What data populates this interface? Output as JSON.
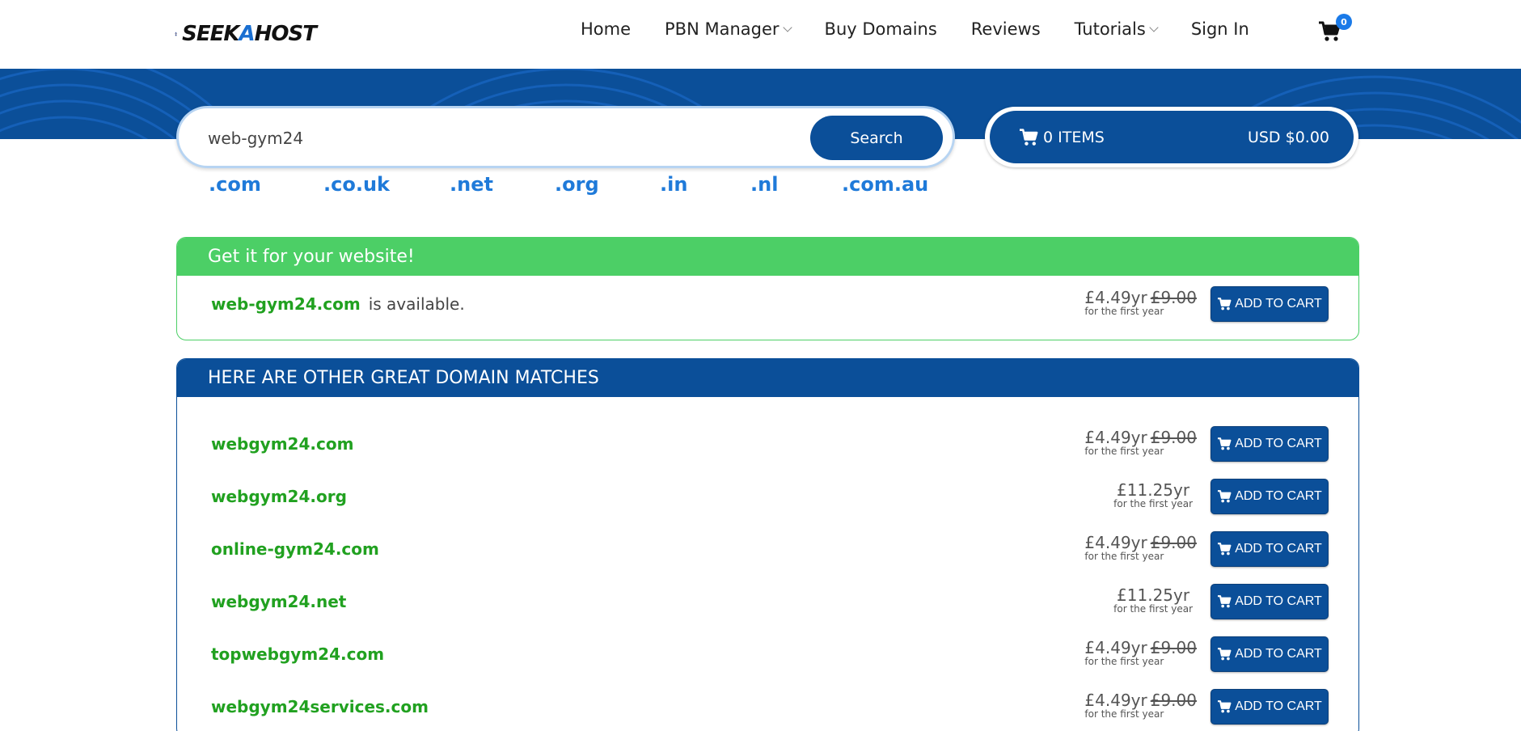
{
  "header": {
    "logo_text_1": "SEEK",
    "logo_text_2": "A",
    "logo_text_3": "HOST",
    "nav": [
      {
        "label": "Home",
        "dropdown": false
      },
      {
        "label": "PBN Manager",
        "dropdown": true
      },
      {
        "label": "Buy Domains",
        "dropdown": false
      },
      {
        "label": "Reviews",
        "dropdown": false
      },
      {
        "label": "Tutorials",
        "dropdown": true
      },
      {
        "label": "Sign In",
        "dropdown": false
      }
    ],
    "cart_count": "0"
  },
  "search": {
    "value": "web-gym24",
    "button_label": "Search"
  },
  "cart_summary": {
    "items": "0 ITEMS",
    "total": "USD $0.00"
  },
  "tlds": [
    ".com",
    ".co.uk",
    ".net",
    ".org",
    ".in",
    ".nl",
    ".com.au"
  ],
  "available": {
    "heading": "Get it for your website!",
    "domain": "web-gym24.com",
    "status_text": "is available.",
    "price": "£4.49yr",
    "old_price": "£9.00",
    "price_note": "for the first year",
    "button_label": "ADD TO CART"
  },
  "matches": {
    "heading": "HERE ARE OTHER GREAT DOMAIN MATCHES",
    "button_label": "ADD TO CART",
    "price_note": "for the first year",
    "rows": [
      {
        "domain": "webgym24.com",
        "price": "£4.49yr",
        "old_price": "£9.00"
      },
      {
        "domain": "webgym24.org",
        "price": "£11.25yr",
        "old_price": ""
      },
      {
        "domain": "online-gym24.com",
        "price": "£4.49yr",
        "old_price": "£9.00"
      },
      {
        "domain": "webgym24.net",
        "price": "£11.25yr",
        "old_price": ""
      },
      {
        "domain": "topwebgym24.com",
        "price": "£4.49yr",
        "old_price": "£9.00"
      },
      {
        "domain": "webgym24services.com",
        "price": "£4.49yr",
        "old_price": "£9.00"
      }
    ]
  },
  "colors": {
    "primary": "#0b4f99",
    "success": "#4ccf66",
    "domain_green": "#21a120",
    "tld_blue": "#1f7ad9"
  }
}
